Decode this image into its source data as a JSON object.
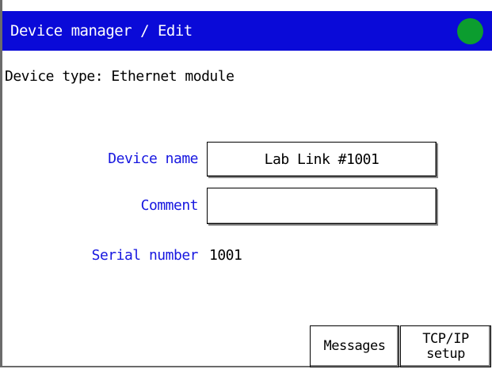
{
  "header": {
    "title": "Device manager / Edit",
    "status_color": "#0c9d2f",
    "bar_color": "#0a0ad8"
  },
  "device_type_line": "Device type: Ethernet module",
  "form": {
    "device_name_label": "Device name",
    "device_name_value": "Lab Link #1001",
    "comment_label": "Comment",
    "comment_value": "",
    "serial_label": "Serial number",
    "serial_value": "1001"
  },
  "buttons": {
    "messages": "Messages",
    "tcpip_line1": "TCP/IP",
    "tcpip_line2": "setup"
  }
}
